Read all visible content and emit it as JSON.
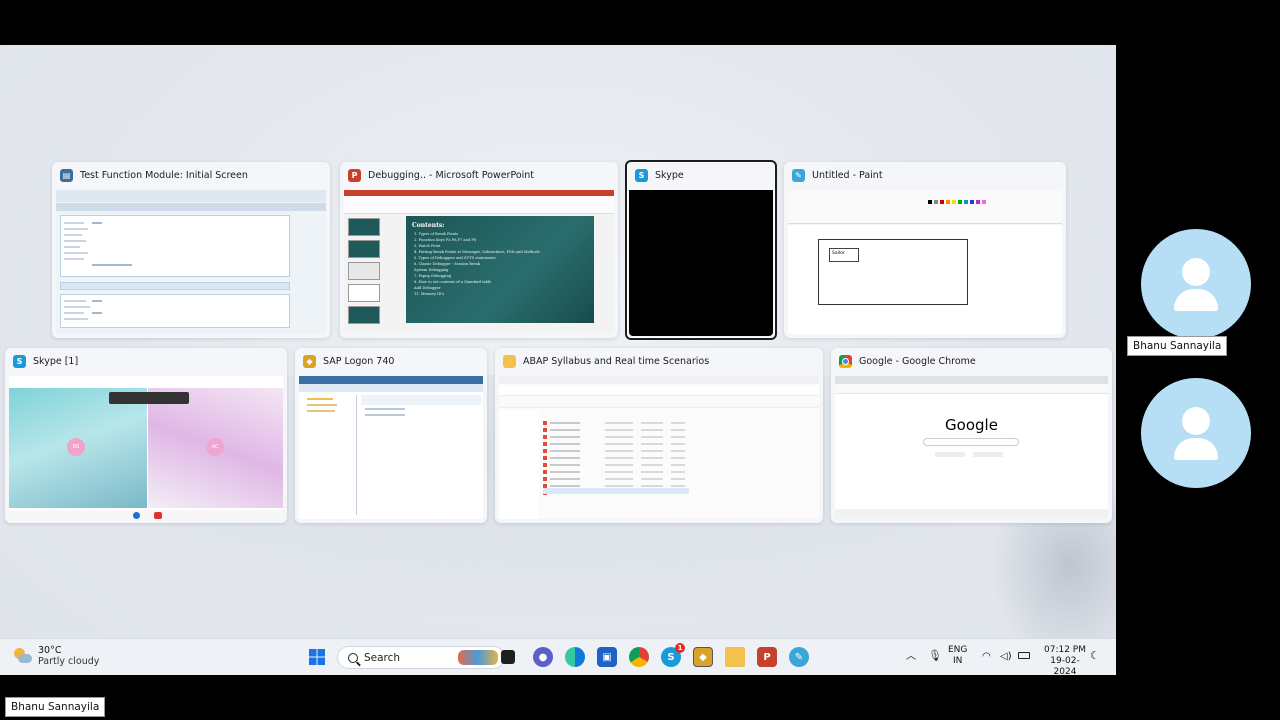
{
  "windows": [
    {
      "title": "Test Function Module: Initial Screen",
      "icon": "sap-function-module-icon"
    },
    {
      "title": "Debugging.. - Microsoft PowerPoint",
      "icon": "powerpoint-icon"
    },
    {
      "title": "Skype",
      "icon": "skype-icon"
    },
    {
      "title": "Untitled - Paint",
      "icon": "paint-icon"
    },
    {
      "title": "Skype [1]",
      "icon": "skype-icon"
    },
    {
      "title": "SAP Logon 740",
      "icon": "sap-logon-icon"
    },
    {
      "title": "ABAP Syllabus and Real time Scenarios",
      "icon": "folder-icon"
    },
    {
      "title": "Google - Google Chrome",
      "icon": "chrome-icon"
    }
  ],
  "powerpoint_slide": {
    "heading": "Contents:",
    "lines": [
      "1. Types of Break Points",
      "2. Function Keys F5,F6,F7 and F8",
      "3. Watch Point",
      "4. Putting Break Points at Messages, Subroutines, FMs and Methods",
      "5. Types of Debuggers and SY-TS statements",
      "6. Classic Debugger - Session Break",
      "   System Debugging",
      "7. Popup Debugging",
      "8. How to set contents of a Standard table",
      "   Add Debugger",
      "11. Memory ID's"
    ]
  },
  "skype_call": {
    "left_initials": "BS",
    "right_initials": "AC"
  },
  "paint_canvas_text": "Sailor",
  "chrome_logo_text": "Google",
  "participants": [
    {
      "name": "Bhanu Sannayila"
    },
    {
      "name": ""
    }
  ],
  "taskbar": {
    "weather_temp": "30°C",
    "weather_condition": "Partly cloudy",
    "search_label": "Search",
    "language_top": "ENG",
    "language_bottom": "IN",
    "time": "07:12 PM",
    "date": "19-02-2024",
    "skype_badge": "1"
  },
  "presenter_label": "Bhanu Sannayila",
  "colors": {
    "taskbar_bg": "#eef2f7",
    "avatar_bg": "#b6def5",
    "ppt_slide_bg": "#1f5a5a",
    "skype_blue": "#1a9ad8"
  }
}
